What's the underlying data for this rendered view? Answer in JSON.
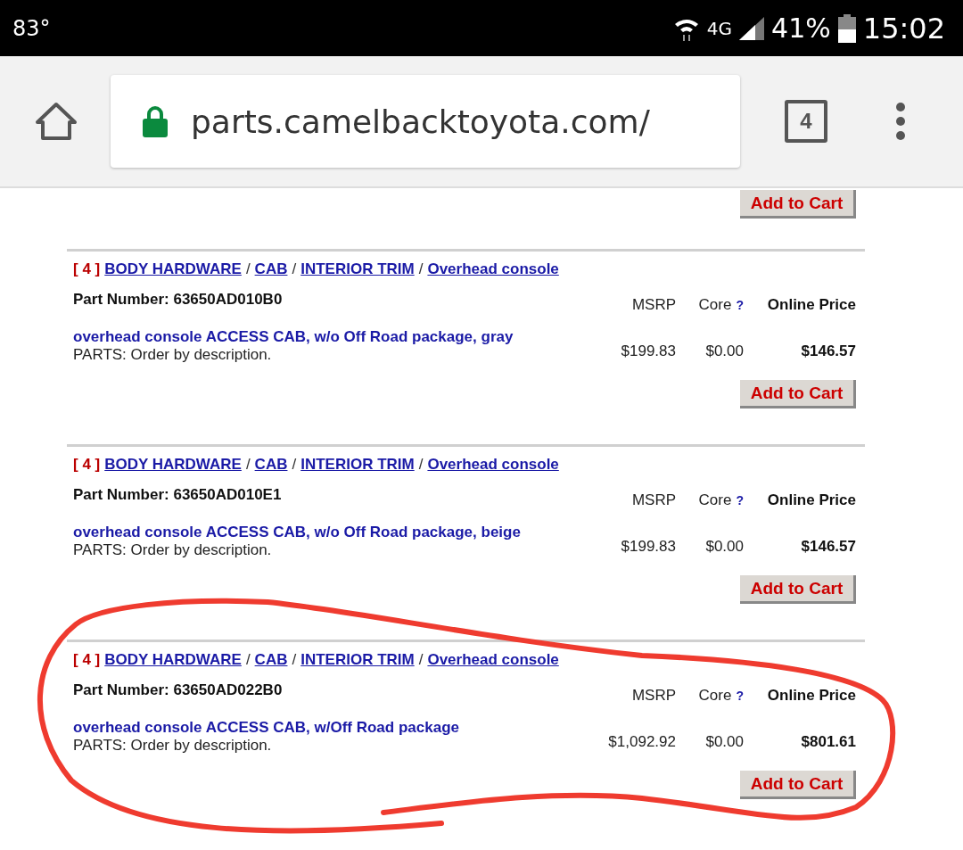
{
  "status_bar": {
    "temperature": "83°",
    "network": "4G",
    "battery": "41%",
    "time": "15:02"
  },
  "browser": {
    "url": "parts.camelbacktoyota.com/",
    "secure": true,
    "tab_count": "4"
  },
  "top_button": "Add to Cart",
  "items": [
    {
      "qty": "[ 4 ]",
      "path": [
        "BODY HARDWARE",
        "CAB",
        "INTERIOR TRIM",
        "Overhead console"
      ],
      "separators": [
        "/",
        "/",
        "/"
      ],
      "part_label": "Part Number:",
      "part_number": "63650AD010B0",
      "description": "overhead console ACCESS CAB, w/o Off Road package, gray",
      "note": "PARTS: Order by description.",
      "headers": [
        "MSRP",
        "Core",
        "?",
        "Online Price"
      ],
      "msrp": "$199.83",
      "core": "$0.00",
      "price": "$146.57",
      "button": "Add to Cart",
      "circled": false
    },
    {
      "qty": "[ 4 ]",
      "path": [
        "BODY HARDWARE",
        "CAB",
        "INTERIOR TRIM",
        "Overhead console"
      ],
      "separators": [
        "/",
        "/",
        "/"
      ],
      "part_label": "Part Number:",
      "part_number": "63650AD010E1",
      "description": "overhead console ACCESS CAB, w/o Off Road package, beige",
      "note": "PARTS: Order by description.",
      "headers": [
        "MSRP",
        "Core",
        "?",
        "Online Price"
      ],
      "msrp": "$199.83",
      "core": "$0.00",
      "price": "$146.57",
      "button": "Add to Cart",
      "circled": false
    },
    {
      "qty": "[ 4 ]",
      "path": [
        "BODY HARDWARE",
        "CAB",
        "INTERIOR TRIM",
        "Overhead console"
      ],
      "separators": [
        "/",
        "/",
        "/"
      ],
      "part_label": "Part Number:",
      "part_number": "63650AD022B0",
      "description": "overhead console ACCESS CAB, w/Off Road package",
      "note": "PARTS: Order by description.",
      "headers": [
        "MSRP",
        "Core",
        "?",
        "Online Price"
      ],
      "msrp": "$1,092.92",
      "core": "$0.00",
      "price": "$801.61",
      "button": "Add to Cart",
      "circled": true
    }
  ]
}
